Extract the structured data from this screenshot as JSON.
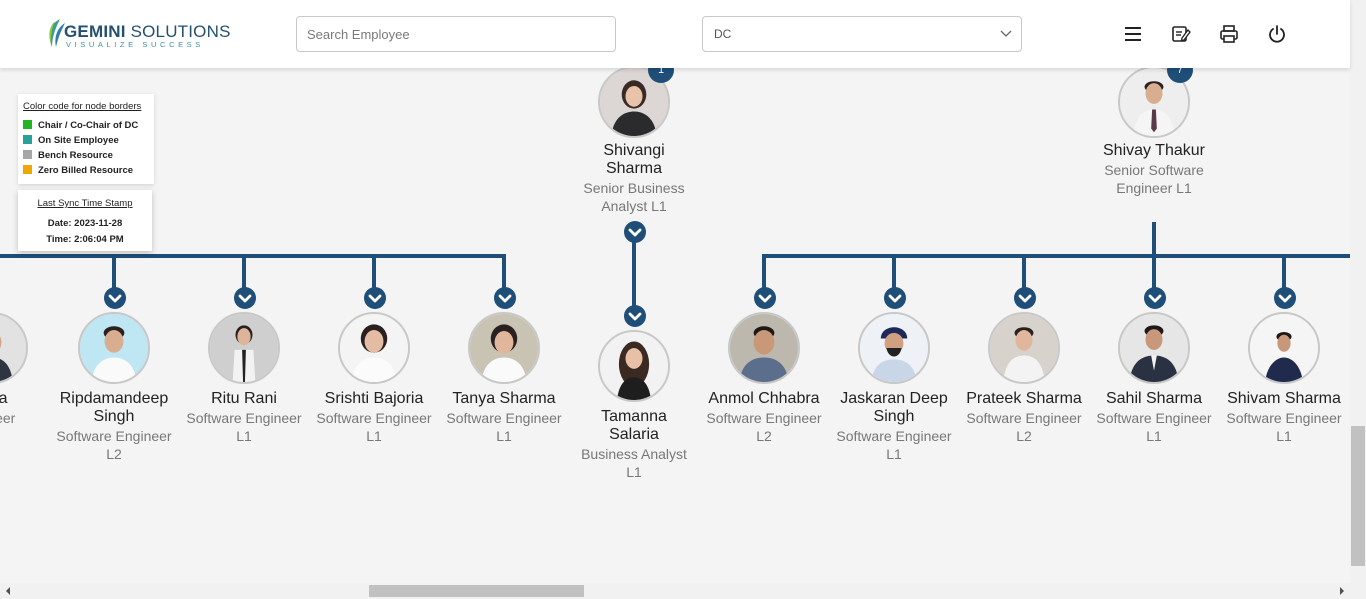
{
  "brand": {
    "name_bold": "GEMINI",
    "name_rest": " SOLUTIONS",
    "tagline": "VISUALIZE SUCCESS"
  },
  "search": {
    "placeholder": "Search Employee",
    "value": ""
  },
  "dc_select": {
    "value": "DC"
  },
  "toolbar": {
    "icons": [
      "menu-icon",
      "edit-note-icon",
      "print-icon",
      "power-icon"
    ]
  },
  "legend": {
    "title": "Color code for node borders",
    "items": [
      {
        "label": "Chair / Co-Chair of DC",
        "color": "#22b522"
      },
      {
        "label": "On Site Employee",
        "color": "#2aa198"
      },
      {
        "label": "Bench Resource",
        "color": "#a6a6a6"
      },
      {
        "label": "Zero Billed Resource",
        "color": "#f0a800"
      }
    ]
  },
  "sync": {
    "title": "Last Sync Time Stamp",
    "date": "Date: 2023-11-28",
    "time": "Time: 2:06:04 PM"
  },
  "colors": {
    "connector": "#1f4e79",
    "badge": "#1f4e79"
  },
  "managers": [
    {
      "name": "Shivangi Sharma",
      "name_l1": "Shivangi",
      "name_l2": "Sharma",
      "role_l1": "Senior Business",
      "role_l2": "Analyst L1",
      "badge": "1"
    },
    {
      "name": "Shivay Thakur",
      "name_l1": "Shivay Thakur",
      "role_l1": "Senior Software",
      "role_l2": "Engineer L1",
      "badge": "7"
    }
  ],
  "reports": [
    {
      "name_l1": "upta",
      "role_l1": "ngineer"
    },
    {
      "name_l1": "Ripdamandeep",
      "name_l2": "Singh",
      "role_l1": "Software Engineer",
      "role_l2": "L2"
    },
    {
      "name_l1": "Ritu Rani",
      "role_l1": "Software Engineer",
      "role_l2": "L1"
    },
    {
      "name_l1": "Srishti Bajoria",
      "role_l1": "Software Engineer",
      "role_l2": "L1"
    },
    {
      "name_l1": "Tanya Sharma",
      "role_l1": "Software Engineer",
      "role_l2": "L1"
    },
    {
      "name_l1": "Tamanna",
      "name_l2": "Salaria",
      "role_l1": "Business Analyst",
      "role_l2": "L1"
    },
    {
      "name_l1": "Anmol Chhabra",
      "role_l1": "Software Engineer",
      "role_l2": "L2"
    },
    {
      "name_l1": "Jaskaran Deep",
      "name_l2": "Singh",
      "role_l1": "Software Engineer",
      "role_l2": "L1"
    },
    {
      "name_l1": "Prateek Sharma",
      "role_l1": "Software Engineer",
      "role_l2": "L2"
    },
    {
      "name_l1": "Sahil Sharma",
      "role_l1": "Software Engineer",
      "role_l2": "L1"
    },
    {
      "name_l1": "Shivam Sharma",
      "role_l1": "Software Engineer",
      "role_l2": "L1"
    }
  ]
}
